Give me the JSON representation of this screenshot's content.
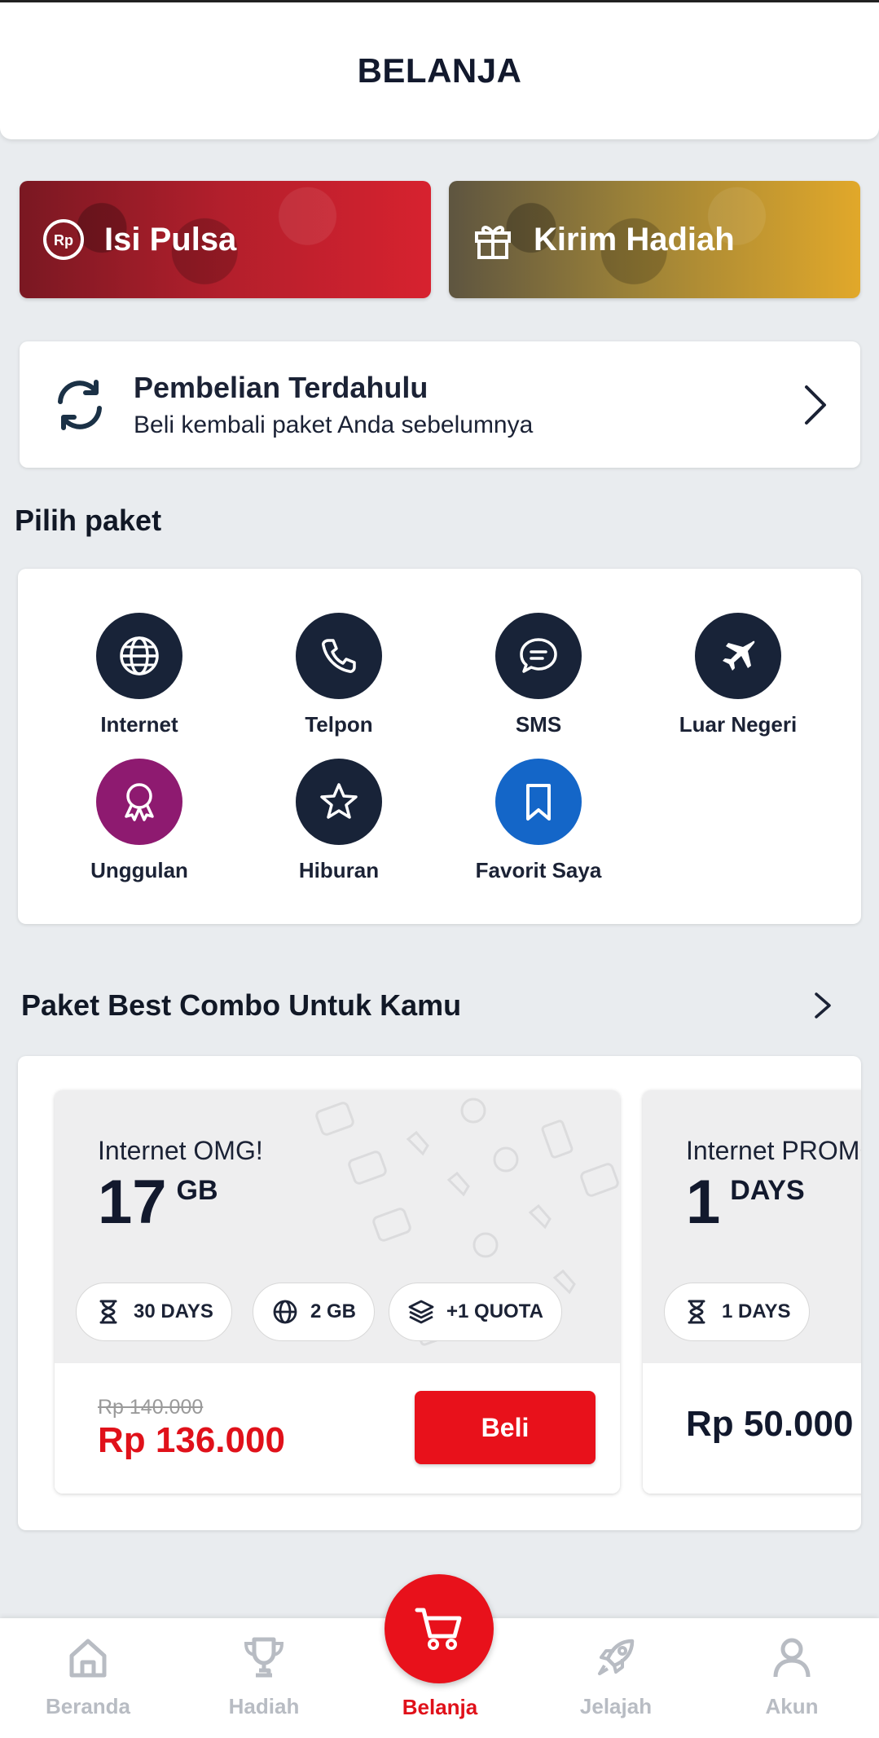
{
  "header": {
    "title": "BELANJA"
  },
  "banners": [
    {
      "label": "Isi Pulsa",
      "icon": "rupiah-coin-icon",
      "color": "#d7222f"
    },
    {
      "label": "Kirim Hadiah",
      "icon": "gift-icon",
      "color": "#e1a82a"
    }
  ],
  "previous_purchase": {
    "title": "Pembelian Terdahulu",
    "subtitle": "Beli kembali paket Anda sebelumnya"
  },
  "pilih_paket": {
    "title": "Pilih paket",
    "categories": [
      {
        "label": "Internet",
        "icon": "globe-icon"
      },
      {
        "label": "Telpon",
        "icon": "phone-icon"
      },
      {
        "label": "SMS",
        "icon": "chat-bubble-icon"
      },
      {
        "label": "Luar Negeri",
        "icon": "airplane-icon"
      },
      {
        "label": "Unggulan",
        "icon": "award-ribbon-icon"
      },
      {
        "label": "Hiburan",
        "icon": "star-icon"
      },
      {
        "label": "Favorit Saya",
        "icon": "bookmark-icon"
      }
    ]
  },
  "best_combo": {
    "title": "Paket Best Combo Untuk Kamu",
    "packages": [
      {
        "name": "Internet OMG!",
        "quantity": "17",
        "unit": "GB",
        "chips": [
          "30 DAYS",
          "2 GB",
          "+1 QUOTA"
        ],
        "old_price": "Rp 140.000",
        "price": "Rp 136.000",
        "button": "Beli"
      },
      {
        "name": "Internet PROMO",
        "quantity": "1",
        "unit": "DAYS",
        "chips": [
          "1 DAYS"
        ],
        "price": "Rp 50.000"
      }
    ]
  },
  "navbar": {
    "items": [
      {
        "label": "Beranda",
        "icon": "home-icon"
      },
      {
        "label": "Hadiah",
        "icon": "trophy-icon"
      },
      {
        "label": "Belanja",
        "icon": "cart-icon",
        "active": true
      },
      {
        "label": "Jelajah",
        "icon": "rocket-icon"
      },
      {
        "label": "Akun",
        "icon": "user-icon"
      }
    ]
  },
  "colors": {
    "accent": "#e8111b",
    "navy": "#182338",
    "purple": "#8e1a70",
    "blue": "#1466c8"
  }
}
